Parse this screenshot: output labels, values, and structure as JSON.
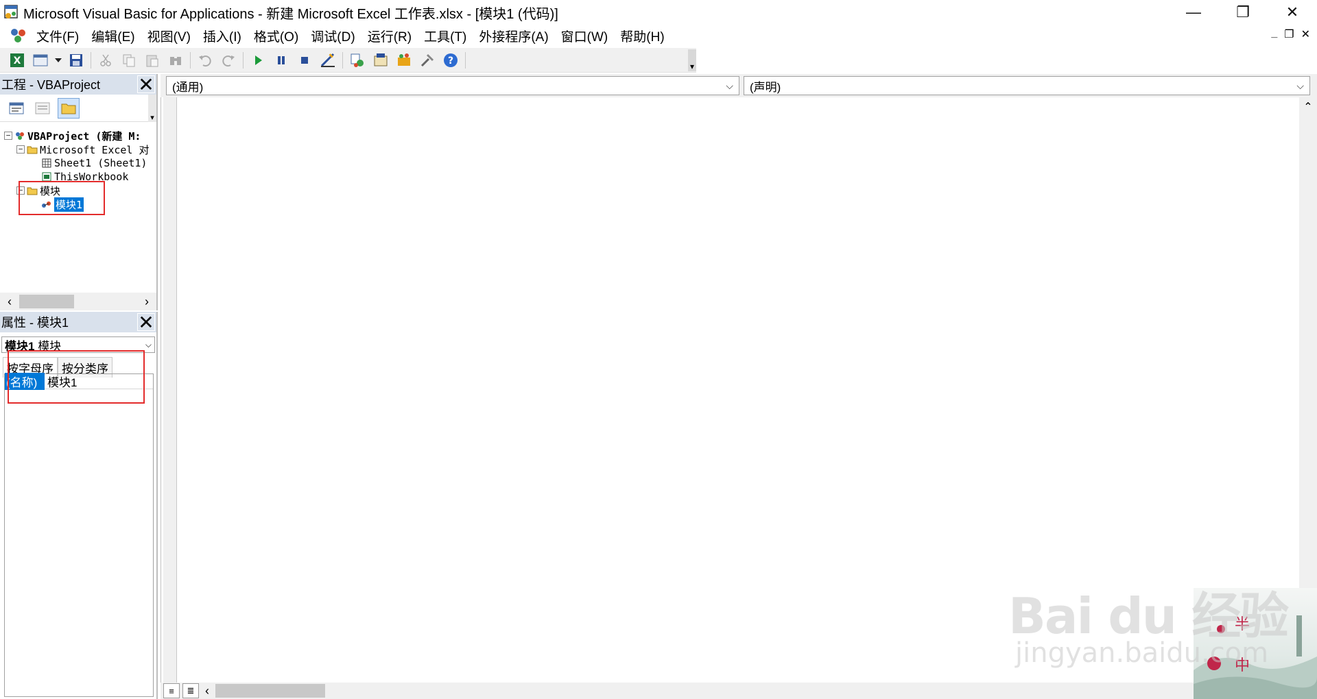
{
  "window": {
    "title": "Microsoft Visual Basic for Applications - 新建 Microsoft Excel 工作表.xlsx - [模块1 (代码)]",
    "minimize_glyph": "—",
    "restore_glyph": "❐",
    "close_glyph": "✕"
  },
  "menu": {
    "items": [
      "文件(F)",
      "编辑(E)",
      "视图(V)",
      "插入(I)",
      "格式(O)",
      "调试(D)",
      "运行(R)",
      "工具(T)",
      "外接程序(A)",
      "窗口(W)",
      "帮助(H)"
    ],
    "mdi_minimize": "_",
    "mdi_restore": "❐",
    "mdi_close": "✕"
  },
  "toolbar": {
    "icons": [
      "excel-icon",
      "insert-userform-icon",
      "save-icon",
      "cut-icon",
      "copy-icon",
      "paste-icon",
      "find-icon",
      "undo-icon",
      "redo-icon",
      "run-icon",
      "break-icon",
      "reset-icon",
      "design-mode-icon",
      "project-explorer-icon",
      "properties-icon",
      "object-browser-icon",
      "toolbox-icon",
      "help-icon"
    ]
  },
  "project_pane": {
    "title": "工程 - VBAProject",
    "close_glyph": "✕",
    "tree": {
      "root": "VBAProject (新建 M:",
      "folder_excel": "Microsoft Excel 对",
      "sheet1": "Sheet1 (Sheet1)",
      "this_workbook": "ThisWorkbook",
      "folder_modules": "模块",
      "module1": "模块1"
    }
  },
  "properties_pane": {
    "title": "属性 - 模块1",
    "close_glyph": "✕",
    "object_name": "模块1",
    "object_type": "模块",
    "tabs": [
      "按字母序",
      "按分类序"
    ],
    "rows": [
      {
        "key": "(名称)",
        "value": "模块1"
      }
    ]
  },
  "code_window": {
    "object_dropdown": "(通用)",
    "procedure_dropdown": "(声明)"
  },
  "watermark": {
    "brand": "Bai du 经验",
    "url": "jingyan.baidu.com"
  },
  "colors": {
    "selection": "#0078d7",
    "pane_header": "#d9e1ec",
    "annotation": "#e32b2b"
  }
}
